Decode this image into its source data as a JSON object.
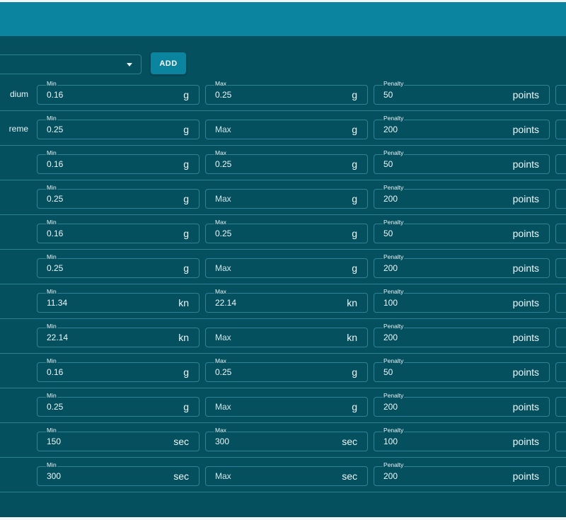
{
  "toolbar": {
    "add_label": "ADD"
  },
  "rows": [
    {
      "label": "dium",
      "min": {
        "label": "Min",
        "value": "0.16"
      },
      "max": {
        "label": "Max",
        "value": "0.25",
        "placeholder": ""
      },
      "unit": "g",
      "penalty": {
        "label": "Penalty",
        "value": "50",
        "unit": "points"
      }
    },
    {
      "label": "reme",
      "min": {
        "label": "Min",
        "value": "0.25"
      },
      "max": {
        "label": "",
        "value": "",
        "placeholder": "Max"
      },
      "unit": "g",
      "penalty": {
        "label": "Penalty",
        "value": "200",
        "unit": "points"
      }
    },
    {
      "label": "",
      "min": {
        "label": "Min",
        "value": "0.16"
      },
      "max": {
        "label": "Max",
        "value": "0.25",
        "placeholder": ""
      },
      "unit": "g",
      "penalty": {
        "label": "Penalty",
        "value": "50",
        "unit": "points"
      }
    },
    {
      "label": "",
      "min": {
        "label": "Min",
        "value": "0.25"
      },
      "max": {
        "label": "",
        "value": "",
        "placeholder": "Max"
      },
      "unit": "g",
      "penalty": {
        "label": "Penalty",
        "value": "200",
        "unit": "points"
      }
    },
    {
      "label": "",
      "min": {
        "label": "Min",
        "value": "0.16"
      },
      "max": {
        "label": "Max",
        "value": "0.25",
        "placeholder": ""
      },
      "unit": "g",
      "penalty": {
        "label": "Penalty",
        "value": "50",
        "unit": "points"
      }
    },
    {
      "label": "",
      "min": {
        "label": "Min",
        "value": "0.25"
      },
      "max": {
        "label": "",
        "value": "",
        "placeholder": "Max"
      },
      "unit": "g",
      "penalty": {
        "label": "Penalty",
        "value": "200",
        "unit": "points"
      }
    },
    {
      "label": "",
      "min": {
        "label": "Min",
        "value": "11.34"
      },
      "max": {
        "label": "Max",
        "value": "22.14",
        "placeholder": ""
      },
      "unit": "kn",
      "penalty": {
        "label": "Penalty",
        "value": "100",
        "unit": "points"
      }
    },
    {
      "label": "",
      "min": {
        "label": "Min",
        "value": "22.14"
      },
      "max": {
        "label": "",
        "value": "",
        "placeholder": "Max"
      },
      "unit": "kn",
      "penalty": {
        "label": "Penalty",
        "value": "200",
        "unit": "points"
      }
    },
    {
      "label": "",
      "min": {
        "label": "Min",
        "value": "0.16"
      },
      "max": {
        "label": "Max",
        "value": "0.25",
        "placeholder": ""
      },
      "unit": "g",
      "penalty": {
        "label": "Penalty",
        "value": "50",
        "unit": "points"
      }
    },
    {
      "label": "",
      "min": {
        "label": "Min",
        "value": "0.25"
      },
      "max": {
        "label": "",
        "value": "",
        "placeholder": "Max"
      },
      "unit": "g",
      "penalty": {
        "label": "Penalty",
        "value": "200",
        "unit": "points"
      }
    },
    {
      "label": "",
      "min": {
        "label": "Min",
        "value": "150"
      },
      "max": {
        "label": "Max",
        "value": "300",
        "placeholder": ""
      },
      "unit": "sec",
      "penalty": {
        "label": "Penalty",
        "value": "100",
        "unit": "points"
      }
    },
    {
      "label": "",
      "min": {
        "label": "Min",
        "value": "300"
      },
      "max": {
        "label": "",
        "value": "",
        "placeholder": "Max"
      },
      "unit": "sec",
      "penalty": {
        "label": "Penalty",
        "value": "200",
        "unit": "points"
      }
    }
  ]
}
